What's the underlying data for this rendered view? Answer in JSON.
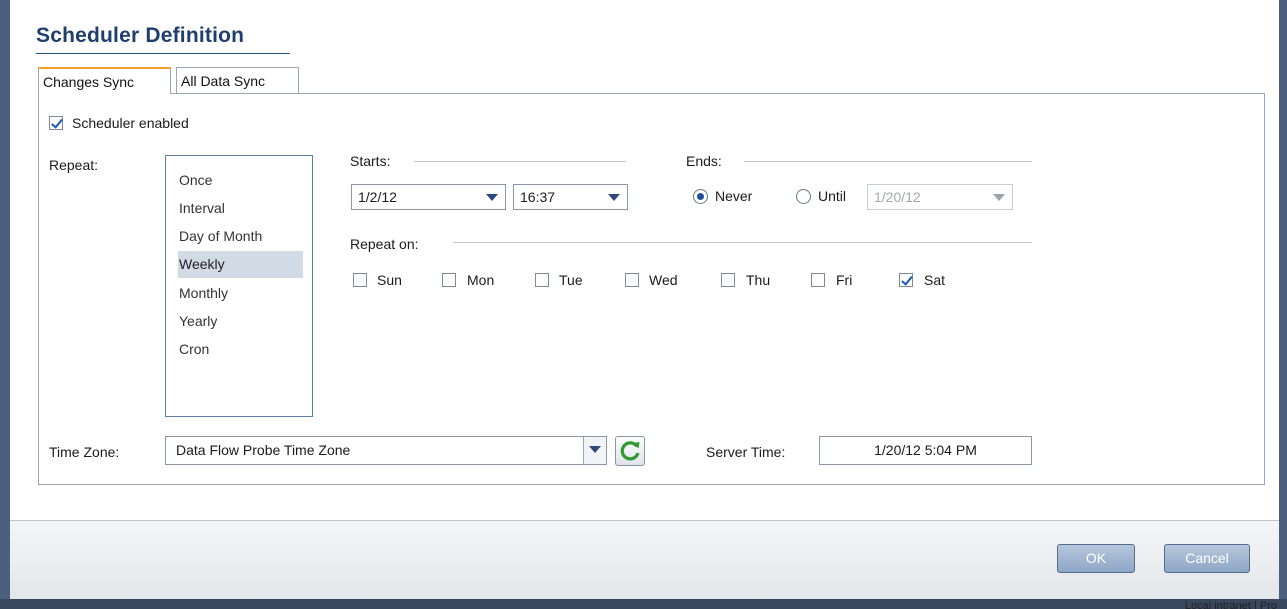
{
  "dialog": {
    "title": "Scheduler Definition",
    "tabs": [
      {
        "label": "Changes Sync",
        "active": true
      },
      {
        "label": "All Data Sync",
        "active": false
      }
    ]
  },
  "scheduler": {
    "enabled_label": "Scheduler enabled",
    "enabled": true
  },
  "repeat": {
    "label": "Repeat:",
    "options": [
      "Once",
      "Interval",
      "Day of Month",
      "Weekly",
      "Monthly",
      "Yearly",
      "Cron"
    ],
    "selected": "Weekly"
  },
  "starts": {
    "label": "Starts:",
    "date": "1/2/12",
    "time": "16:37"
  },
  "ends": {
    "label": "Ends:",
    "never_label": "Never",
    "until_label": "Until",
    "selected": "Never",
    "until_date": "1/20/12"
  },
  "repeat_on": {
    "label": "Repeat on:",
    "days": [
      {
        "label": "Sun",
        "checked": false
      },
      {
        "label": "Mon",
        "checked": false
      },
      {
        "label": "Tue",
        "checked": false
      },
      {
        "label": "Wed",
        "checked": false
      },
      {
        "label": "Thu",
        "checked": false
      },
      {
        "label": "Fri",
        "checked": false
      },
      {
        "label": "Sat",
        "checked": true
      }
    ]
  },
  "time_zone": {
    "label": "Time Zone:",
    "value": "Data Flow Probe Time Zone",
    "refresh_icon": "refresh-icon"
  },
  "server_time": {
    "label": "Server Time:",
    "value": "1/20/12 5:04 PM"
  },
  "buttons": {
    "ok": "OK",
    "cancel": "Cancel"
  },
  "taskbar": {
    "text": "Local intranet | Pro"
  },
  "colors": {
    "title": "#1f3f6e",
    "active_tab_accent": "#f1a129",
    "selection": "#d2dae6",
    "button": "#8ea6c6"
  }
}
